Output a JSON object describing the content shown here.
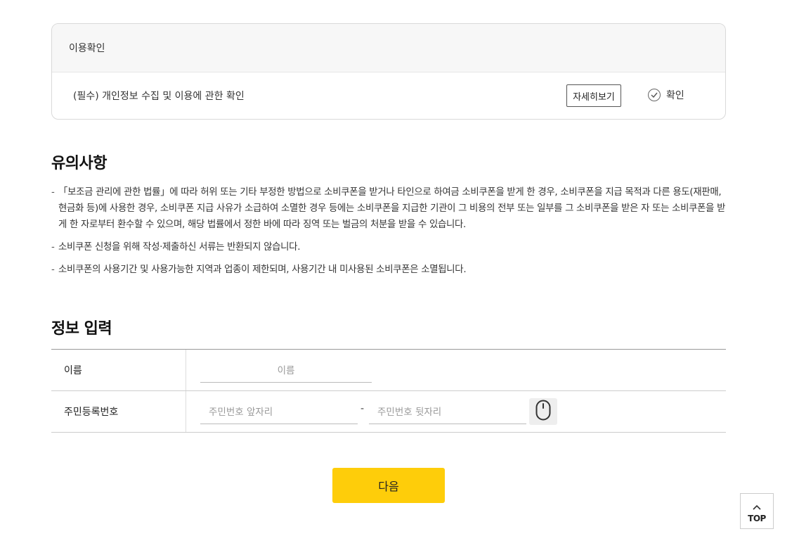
{
  "consent": {
    "header": "이용확인",
    "item_text": "(필수) 개인정보 수집 및 이용에 관한 확인",
    "detail_button": "자세히보기",
    "confirm_label": "확인"
  },
  "notice": {
    "title": "유의사항",
    "items": [
      "「보조금 관리에 관한 법률」에 따라 허위 또는 기타 부정한 방법으로 소비쿠폰을 받거나 타인으로 하여금 소비쿠폰을 받게 한 경우, 소비쿠폰을 지급 목적과 다른 용도(재판매, 현금화 등)에 사용한 경우, 소비쿠폰 지급 사유가 소급하여 소멸한 경우 등에는 소비쿠폰을 지급한 기관이 그 비용의 전부 또는 일부를 그 소비쿠폰을 받은 자 또는 소비쿠폰을 받게 한 자로부터 환수할 수 있으며, 해당 법률에서 정한 바에 따라 징역 또는 벌금의 처분을 받을 수 있습니다.",
      "소비쿠폰 신청을 위해 작성·제출하신 서류는 반환되지 않습니다.",
      "소비쿠폰의 사용기간 및 사용가능한 지역과 업종이 제한되며, 사용기간 내 미사용된 소비쿠폰은 소멸됩니다."
    ]
  },
  "form": {
    "title": "정보 입력",
    "name_label": "이름",
    "name_placeholder": "이름",
    "rrn_label": "주민등록번호",
    "rrn_front_placeholder": "주민번호 앞자리",
    "rrn_separator": "-",
    "rrn_back_placeholder": "주민번호 뒷자리",
    "mouse_icon": "mouse-icon"
  },
  "next_button": "다음",
  "top_button": "TOP",
  "colors": {
    "primary_button": "#fecd0a",
    "consent_header_bg": "#f7f7f7"
  }
}
